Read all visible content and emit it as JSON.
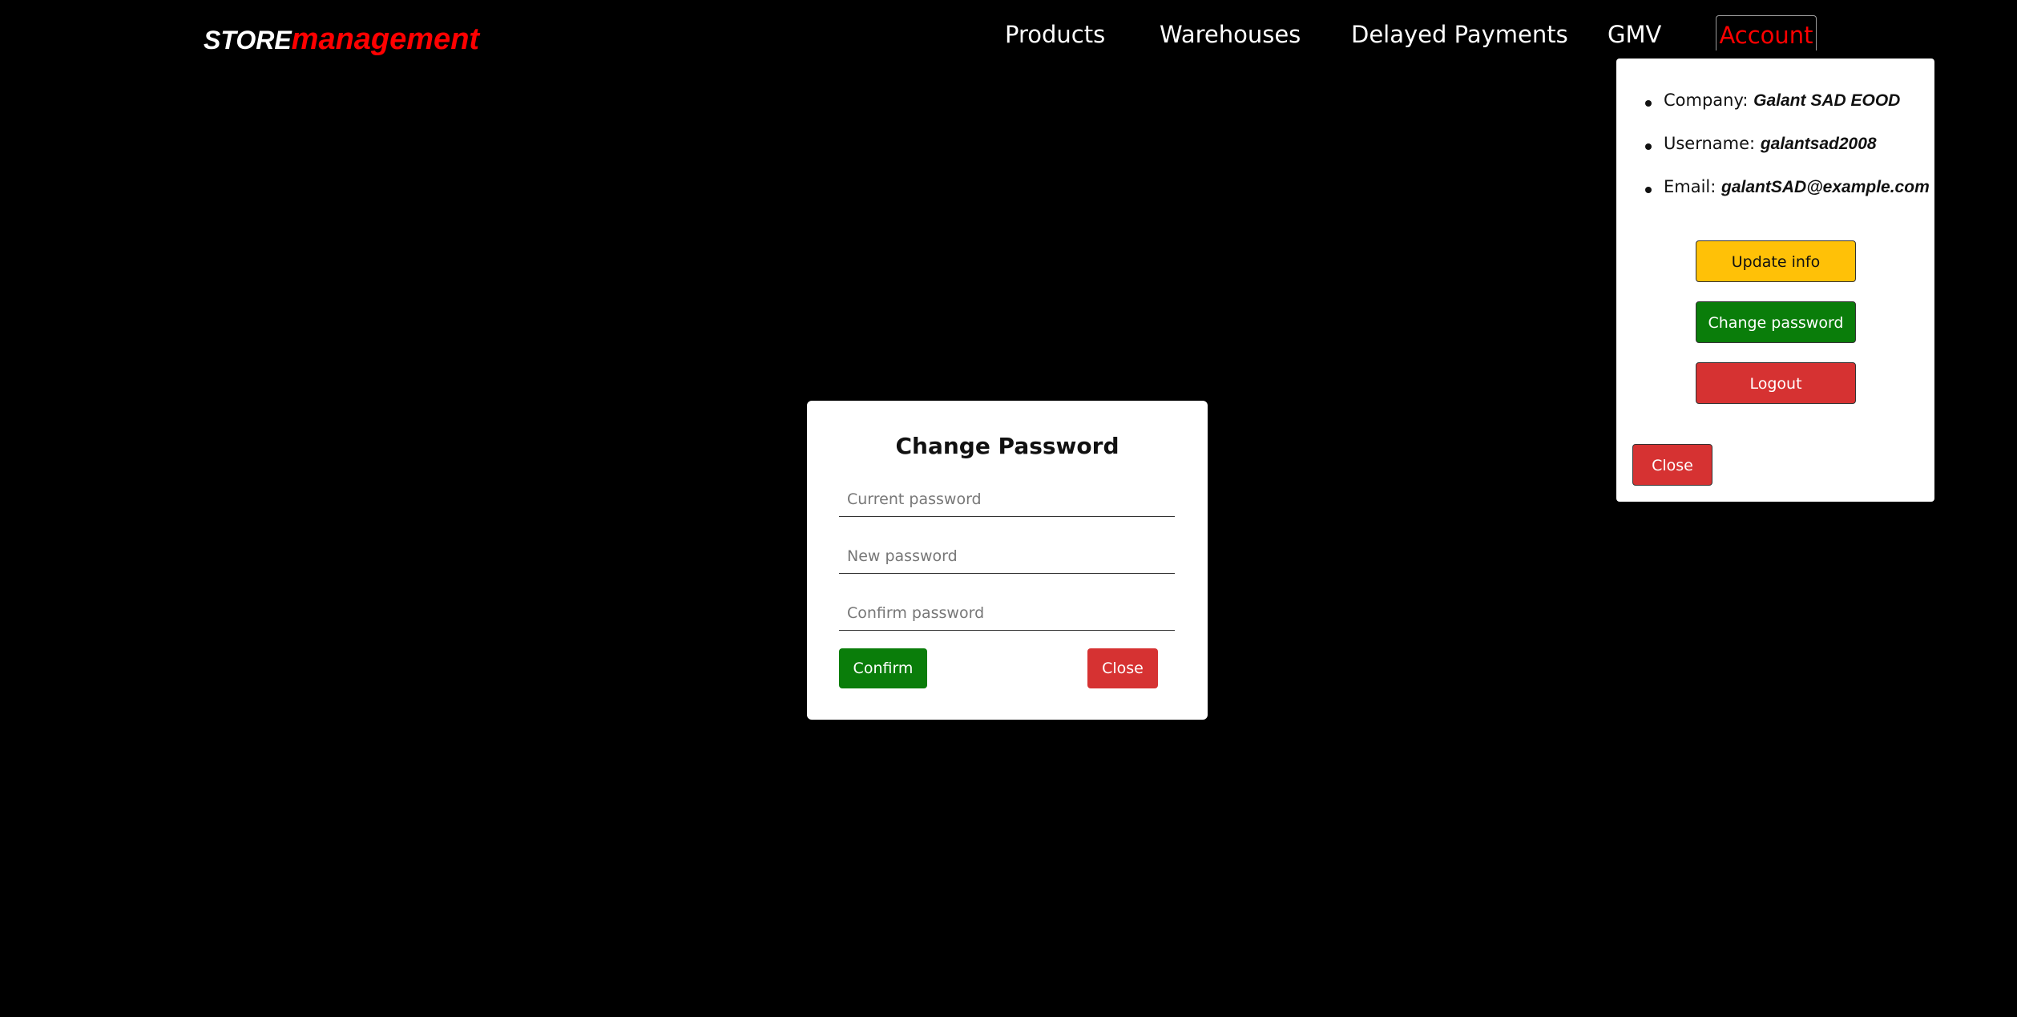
{
  "logo": {
    "part1": "STORE",
    "part2": "management"
  },
  "nav": {
    "items": [
      {
        "label": "Products"
      },
      {
        "label": "Warehouses"
      },
      {
        "label": "Delayed Payments"
      },
      {
        "label": "GMV"
      }
    ],
    "account_label": "Account",
    "account_color": "#ff0000"
  },
  "account_panel": {
    "company_label": "Company: ",
    "company_value": "Galant SAD EOOD",
    "username_label": "Username: ",
    "username_value": "galantsad2008",
    "email_label": "Email: ",
    "email_value": "galantSAD@example.com",
    "update_label": "Update info",
    "change_password_label": "Change password",
    "logout_label": "Logout",
    "close_label": "Close"
  },
  "modal": {
    "title": "Change Password",
    "current_placeholder": "Current password",
    "new_placeholder": "New password",
    "confirm_placeholder": "Confirm password",
    "confirm_label": "Confirm",
    "close_label": "Close"
  },
  "colors": {
    "background": "#000000",
    "accent_red": "#ff0000",
    "update_yellow": "#ffc107",
    "confirm_green": "#0a7d0a",
    "danger_red": "#d63232"
  }
}
